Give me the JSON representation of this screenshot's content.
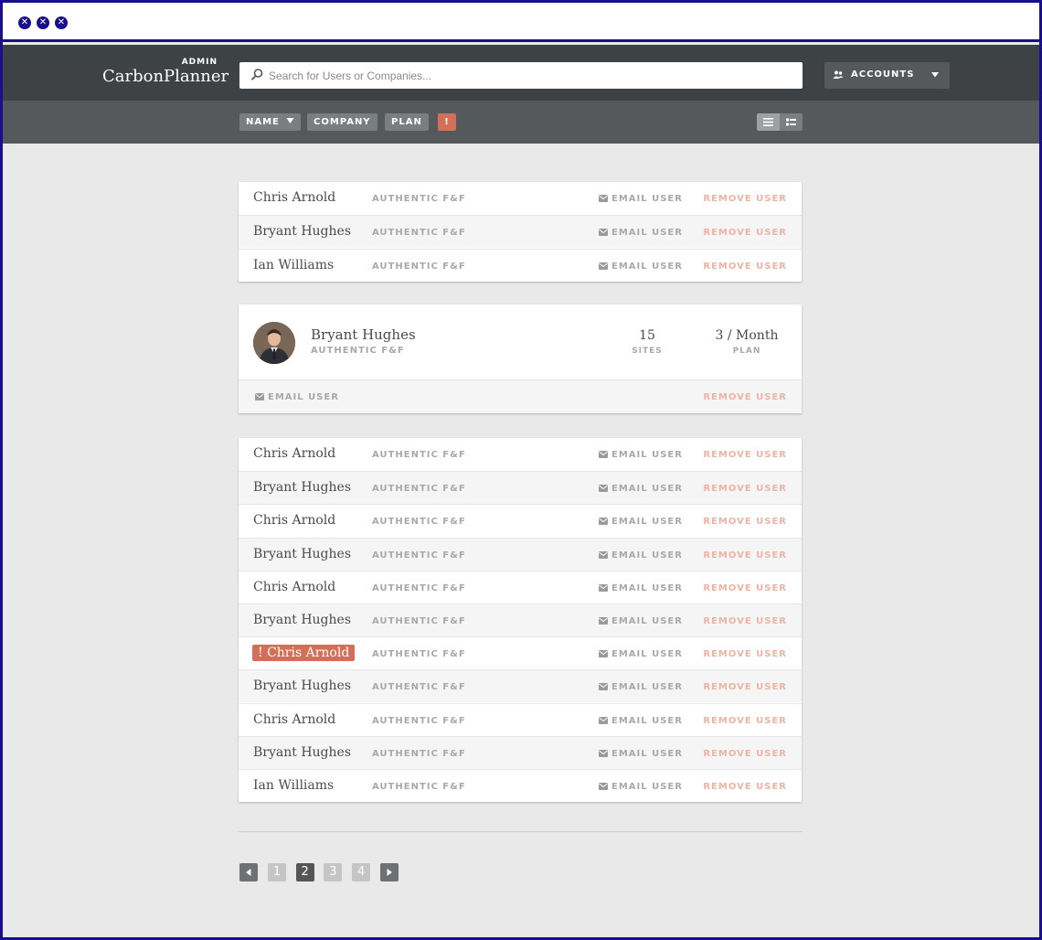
{
  "window": {
    "controls": [
      "close",
      "minimize",
      "maximize"
    ]
  },
  "header": {
    "admin_label": "ADMIN",
    "app_name": "CarbonPlanner",
    "search_placeholder": "Search for Users or Companies...",
    "accounts_label": "ACCOUNTS"
  },
  "filters": {
    "name_label": "NAME",
    "company_label": "COMPANY",
    "plan_label": "PLAN",
    "alert_label": "!"
  },
  "colors": {
    "header_bg": "#3e4244",
    "filterbar_bg": "#55595c",
    "accent": "#d36f58",
    "remove_text": "#edb4a4"
  },
  "list1": [
    {
      "name": "Chris Arnold",
      "company": "AUTHENTIC F&F",
      "email": "EMAIL USER",
      "remove": "REMOVE USER"
    },
    {
      "name": "Bryant Hughes",
      "company": "AUTHENTIC F&F",
      "email": "EMAIL USER",
      "remove": "REMOVE USER"
    },
    {
      "name": "Ian Williams",
      "company": "AUTHENTIC F&F",
      "email": "EMAIL USER",
      "remove": "REMOVE USER"
    }
  ],
  "detail": {
    "name": "Bryant Hughes",
    "company": "AUTHENTIC F&F",
    "sites_value": "15",
    "sites_label": "SITES",
    "plan_value": "3 / Month",
    "plan_label": "PLAN",
    "email": "EMAIL USER",
    "remove": "REMOVE USER"
  },
  "list2": [
    {
      "name": "Chris Arnold",
      "company": "AUTHENTIC F&F",
      "email": "EMAIL USER",
      "remove": "REMOVE USER",
      "flagged": false
    },
    {
      "name": "Bryant Hughes",
      "company": "AUTHENTIC F&F",
      "email": "EMAIL USER",
      "remove": "REMOVE USER",
      "flagged": false
    },
    {
      "name": "Chris Arnold",
      "company": "AUTHENTIC F&F",
      "email": "EMAIL USER",
      "remove": "REMOVE USER",
      "flagged": false
    },
    {
      "name": "Bryant Hughes",
      "company": "AUTHENTIC F&F",
      "email": "EMAIL USER",
      "remove": "REMOVE USER",
      "flagged": false
    },
    {
      "name": "Chris Arnold",
      "company": "AUTHENTIC F&F",
      "email": "EMAIL USER",
      "remove": "REMOVE USER",
      "flagged": false
    },
    {
      "name": "Bryant Hughes",
      "company": "AUTHENTIC F&F",
      "email": "EMAIL USER",
      "remove": "REMOVE USER",
      "flagged": false
    },
    {
      "name": "! Chris Arnold",
      "company": "AUTHENTIC F&F",
      "email": "EMAIL USER",
      "remove": "REMOVE USER",
      "flagged": true
    },
    {
      "name": "Bryant Hughes",
      "company": "AUTHENTIC F&F",
      "email": "EMAIL USER",
      "remove": "REMOVE USER",
      "flagged": false
    },
    {
      "name": "Chris Arnold",
      "company": "AUTHENTIC F&F",
      "email": "EMAIL USER",
      "remove": "REMOVE USER",
      "flagged": false
    },
    {
      "name": "Bryant Hughes",
      "company": "AUTHENTIC F&F",
      "email": "EMAIL USER",
      "remove": "REMOVE USER",
      "flagged": false
    },
    {
      "name": "Ian Williams",
      "company": "AUTHENTIC F&F",
      "email": "EMAIL USER",
      "remove": "REMOVE USER",
      "flagged": false
    }
  ],
  "pagination": {
    "pages": [
      "1",
      "2",
      "3",
      "4"
    ],
    "current": "2"
  }
}
